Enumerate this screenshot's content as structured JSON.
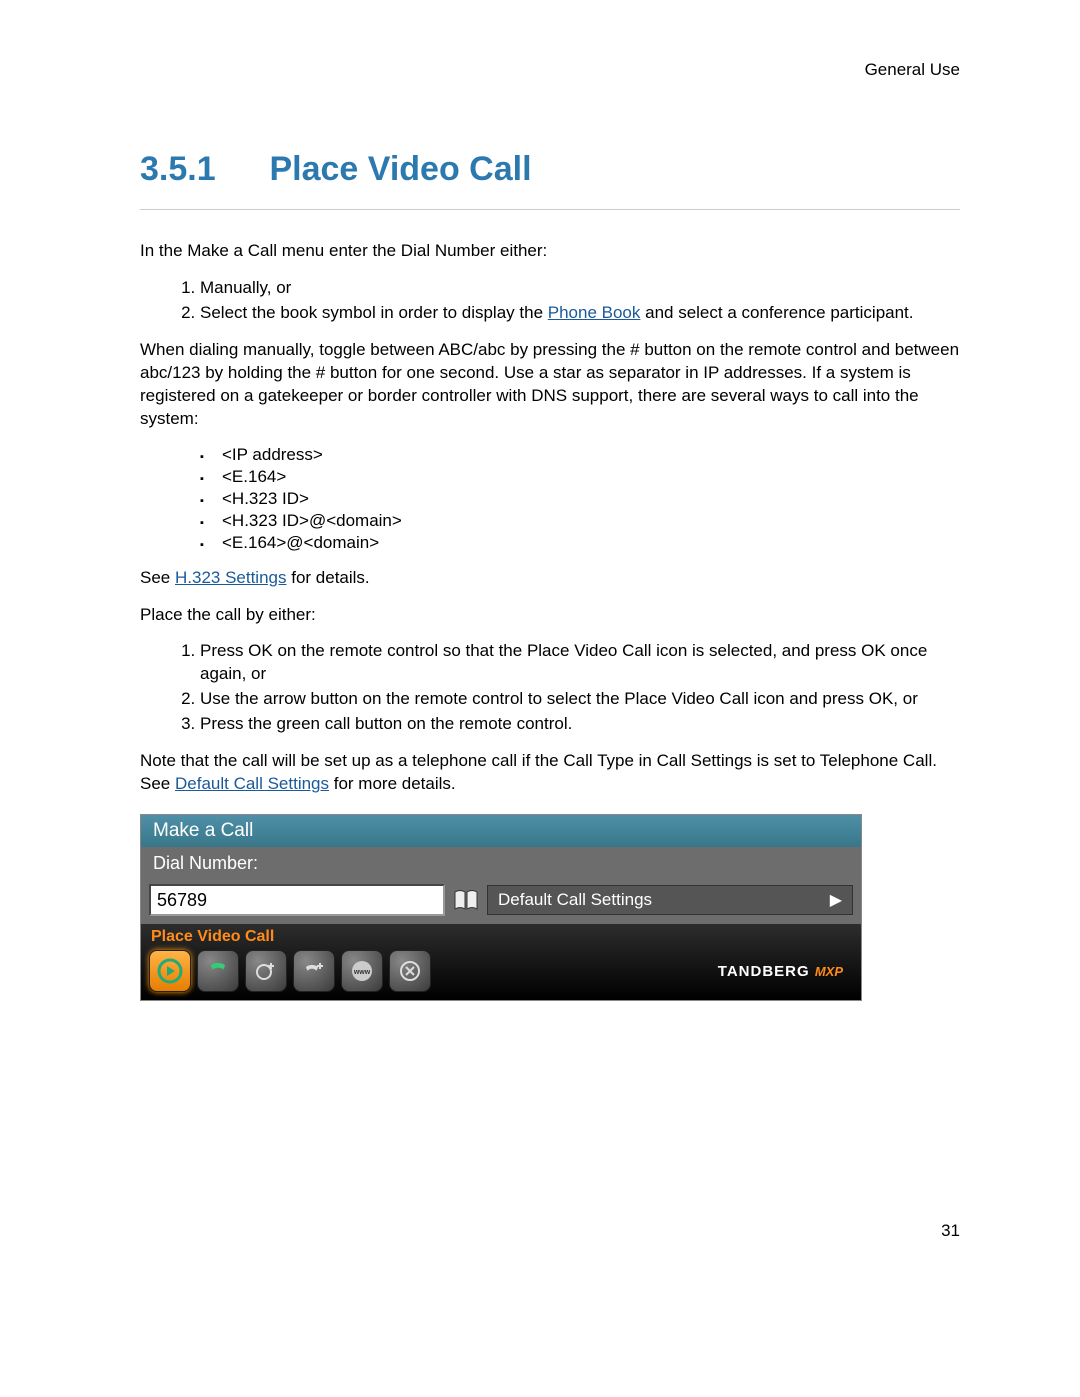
{
  "header": {
    "section": "General Use"
  },
  "title": {
    "number": "3.5.1",
    "text": "Place Video Call"
  },
  "intro": "In the Make a Call menu enter the Dial Number either:",
  "intro_list": [
    "Manually, or",
    {
      "pre": "Select the book symbol in order to display the ",
      "link": "Phone Book",
      "post": " and select a conference participant."
    }
  ],
  "para2": "When dialing manually, toggle between ABC/abc by pressing the # button on the remote control and between abc/123 by holding the # button for one second. Use a star as separator in IP addresses. If a system is registered on a gatekeeper or border controller with DNS support, there are several ways to call into the system:",
  "bullets": [
    "<IP address>",
    "<E.164>",
    "<H.323 ID>",
    "<H.323 ID>@<domain>",
    "<E.164>@<domain>"
  ],
  "see_line": {
    "pre": "See ",
    "link": "H.323 Settings",
    "post": " for details."
  },
  "place_intro": "Place the call by either:",
  "place_list": [
    "Press OK on the remote control so that the Place Video Call icon is selected, and press OK once again, or",
    "Use the arrow button on the remote control to select the Place Video Call icon and press OK, or",
    "Press the green call button on the remote control."
  ],
  "note": {
    "pre": "Note that the call will be set up as a telephone call if the Call Type in Call Settings is set to Telephone Call. See ",
    "link": "Default Call Settings",
    "post": " for more details."
  },
  "ui": {
    "title": "Make a Call",
    "dial_label": "Dial Number:",
    "dial_value": "56789",
    "settings_label": "Default Call Settings",
    "action_label": "Place Video Call",
    "brand": "TANDBERG",
    "brand_suffix": "MXP"
  },
  "page_number": "31"
}
